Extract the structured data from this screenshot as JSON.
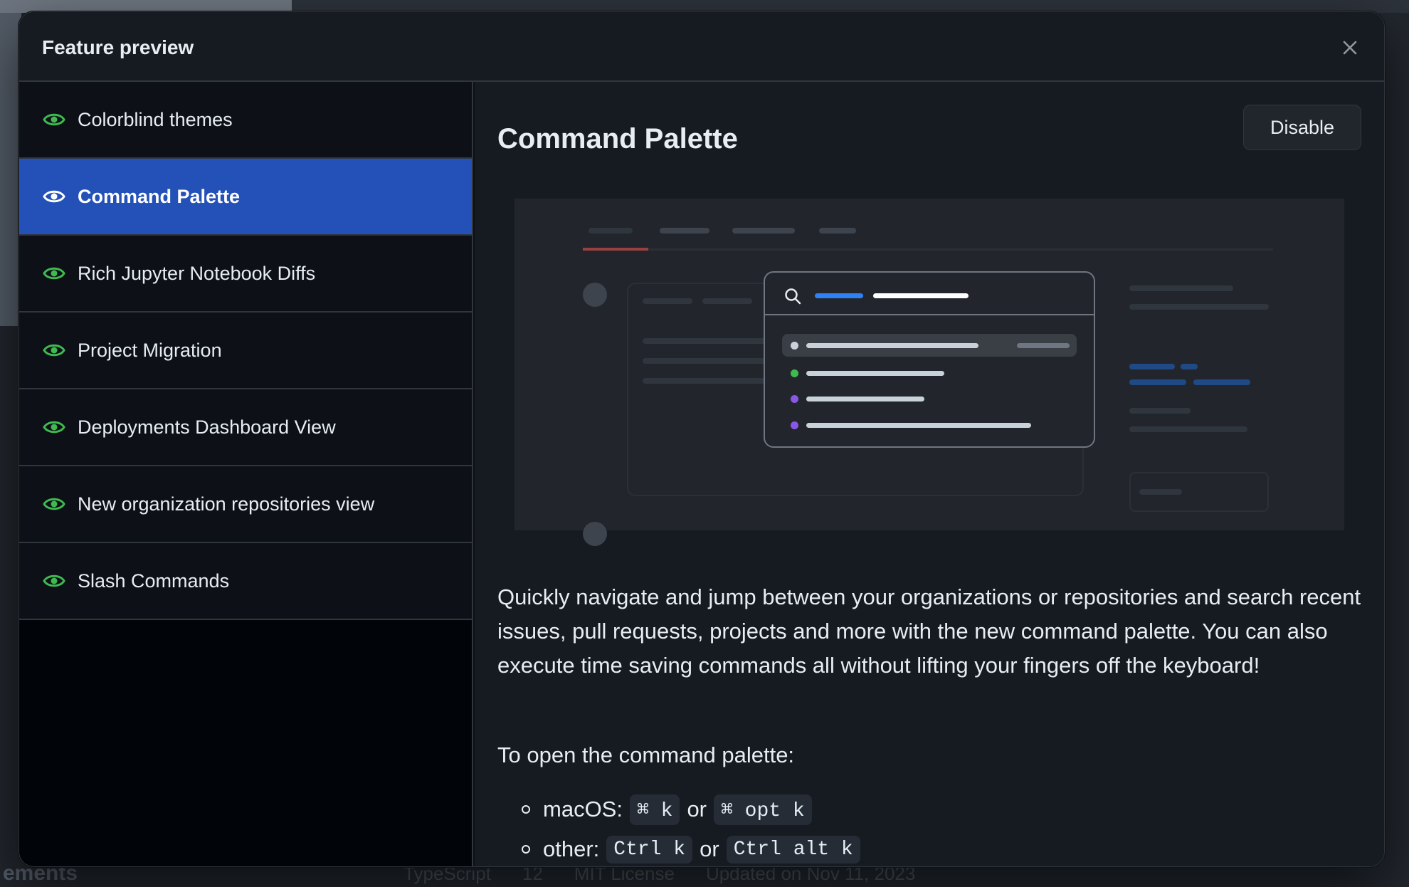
{
  "background": {
    "bottom_label": "ements",
    "meta": [
      "TypeScript",
      "12",
      "MIT License",
      "Updated on Nov 11, 2023"
    ]
  },
  "modal": {
    "title": "Feature preview",
    "close_icon": "x-icon"
  },
  "sidebar": {
    "items": [
      {
        "label": "Colorblind themes",
        "icon": "eye-icon",
        "active": false
      },
      {
        "label": "Command Palette",
        "icon": "eye-icon",
        "active": true
      },
      {
        "label": "Rich Jupyter Notebook Diffs",
        "icon": "eye-icon",
        "active": false
      },
      {
        "label": "Project Migration",
        "icon": "eye-icon",
        "active": false
      },
      {
        "label": "Deployments Dashboard View",
        "icon": "eye-icon",
        "active": false
      },
      {
        "label": "New organization repositories view",
        "icon": "eye-icon",
        "active": false
      },
      {
        "label": "Slash Commands",
        "icon": "eye-icon",
        "active": false
      }
    ]
  },
  "content": {
    "title": "Command Palette",
    "disable_label": "Disable",
    "description": "Quickly navigate and jump between your organizations or repositories and search recent issues, pull requests, projects and more with the new command palette. You can also execute time saving commands all without lifting your fingers off the keyboard!",
    "howto": "To open the command palette:",
    "shortcuts": {
      "macos_label": "macOS:",
      "macos_key1": "⌘ k",
      "macos_or": "or",
      "macos_key2": "⌘ opt k",
      "other_label": "other:",
      "other_key1": "Ctrl k",
      "other_or": "or",
      "other_key2": "Ctrl alt k"
    }
  },
  "colors": {
    "accent": "#2451b8",
    "eye_icon": "#3fb950",
    "modal_bg": "#0d1117",
    "content_bg": "#161b22",
    "palette_blue": "#2f81f7",
    "palette_green": "#3fb950",
    "palette_purple": "#8957e5",
    "tab_underline": "#f85149"
  }
}
